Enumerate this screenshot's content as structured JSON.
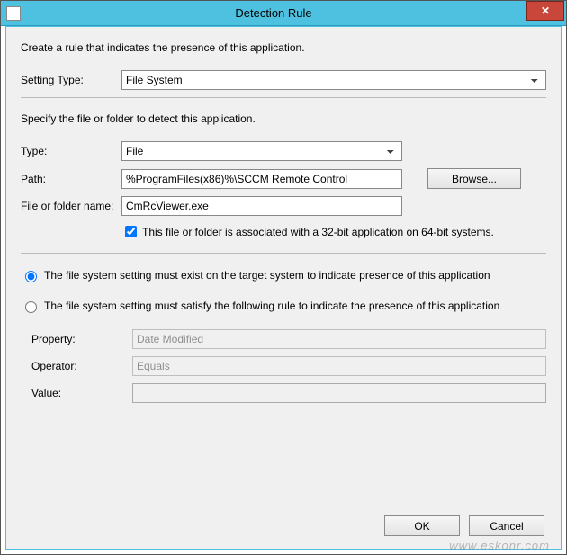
{
  "window": {
    "title": "Detection Rule",
    "close_hint": "✕"
  },
  "intro": "Create a rule that indicates the presence of this application.",
  "setting_type": {
    "label": "Setting Type:",
    "value": "File System"
  },
  "specify_header": "Specify the file or folder to detect this application.",
  "type": {
    "label": "Type:",
    "value": "File"
  },
  "path": {
    "label": "Path:",
    "value": "%ProgramFiles(x86)%\\SCCM Remote Control",
    "browse": "Browse..."
  },
  "file_or_folder": {
    "label": "File or folder name:",
    "value": "CmRcViewer.exe"
  },
  "assoc_checkbox": {
    "label": "This file or folder is associated with a 32-bit application on 64-bit systems."
  },
  "radio_exist": "The file system setting must exist on the target system to indicate presence of this application",
  "radio_rule": "The file system setting must satisfy the following rule to indicate the presence of this application",
  "property": {
    "label": "Property:",
    "value": "Date Modified"
  },
  "operator": {
    "label": "Operator:",
    "value": "Equals"
  },
  "value": {
    "label": "Value:",
    "value": ""
  },
  "buttons": {
    "ok": "OK",
    "cancel": "Cancel"
  },
  "watermark": "www.eskonr.com"
}
